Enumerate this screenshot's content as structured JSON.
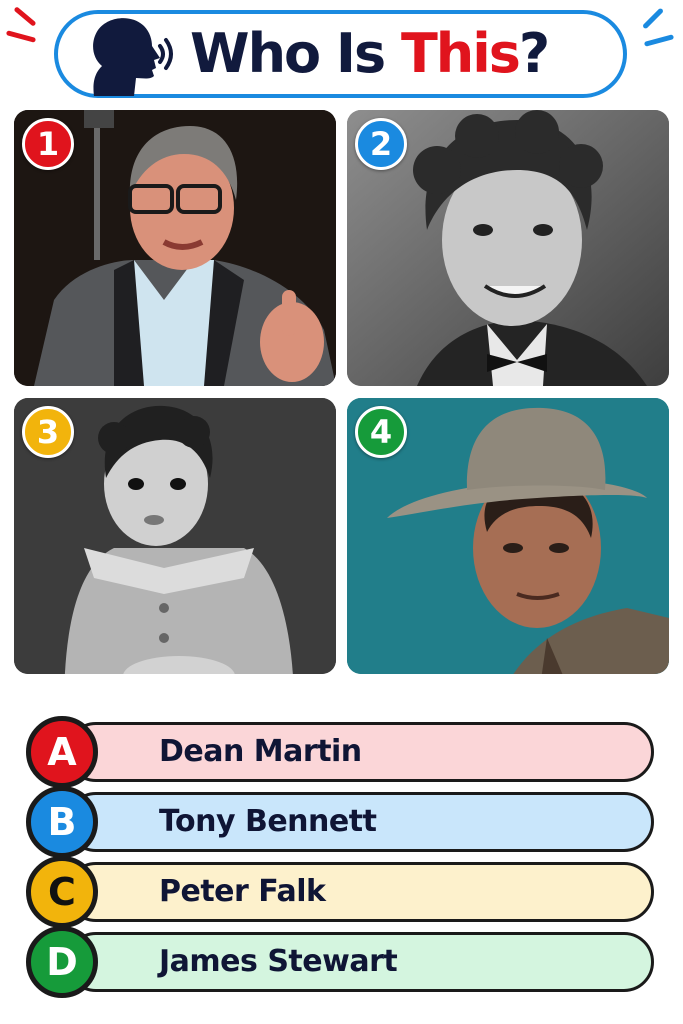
{
  "header": {
    "title_part1": "Who Is ",
    "title_part2": "This",
    "title_part3": "?",
    "icon": "speaking-head-icon"
  },
  "colors": {
    "title_dark": "#111a3d",
    "title_accent": "#e0141d",
    "pill_border": "#1a8ae0"
  },
  "photos": [
    {
      "number": "1",
      "badge_color": "#e0141d",
      "subject": "older-man-glasses"
    },
    {
      "number": "2",
      "badge_color": "#1a8ae0",
      "subject": "young-man-bowtie"
    },
    {
      "number": "3",
      "badge_color": "#f2b40c",
      "subject": "toddler"
    },
    {
      "number": "4",
      "badge_color": "#169b3a",
      "subject": "cowboy"
    }
  ],
  "answers": [
    {
      "letter": "A",
      "label": "Dean Martin",
      "circle_color": "#e0141d",
      "bar_color": "#fbd6d8"
    },
    {
      "letter": "B",
      "label": "Tony Bennett",
      "circle_color": "#1a8ae0",
      "bar_color": "#c9e6fb"
    },
    {
      "letter": "C",
      "label": "Peter Falk",
      "circle_color": "#f2b40c",
      "bar_color": "#fdf1cc"
    },
    {
      "letter": "D",
      "label": "James Stewart",
      "circle_color": "#169b3a",
      "bar_color": "#d4f5df"
    }
  ]
}
